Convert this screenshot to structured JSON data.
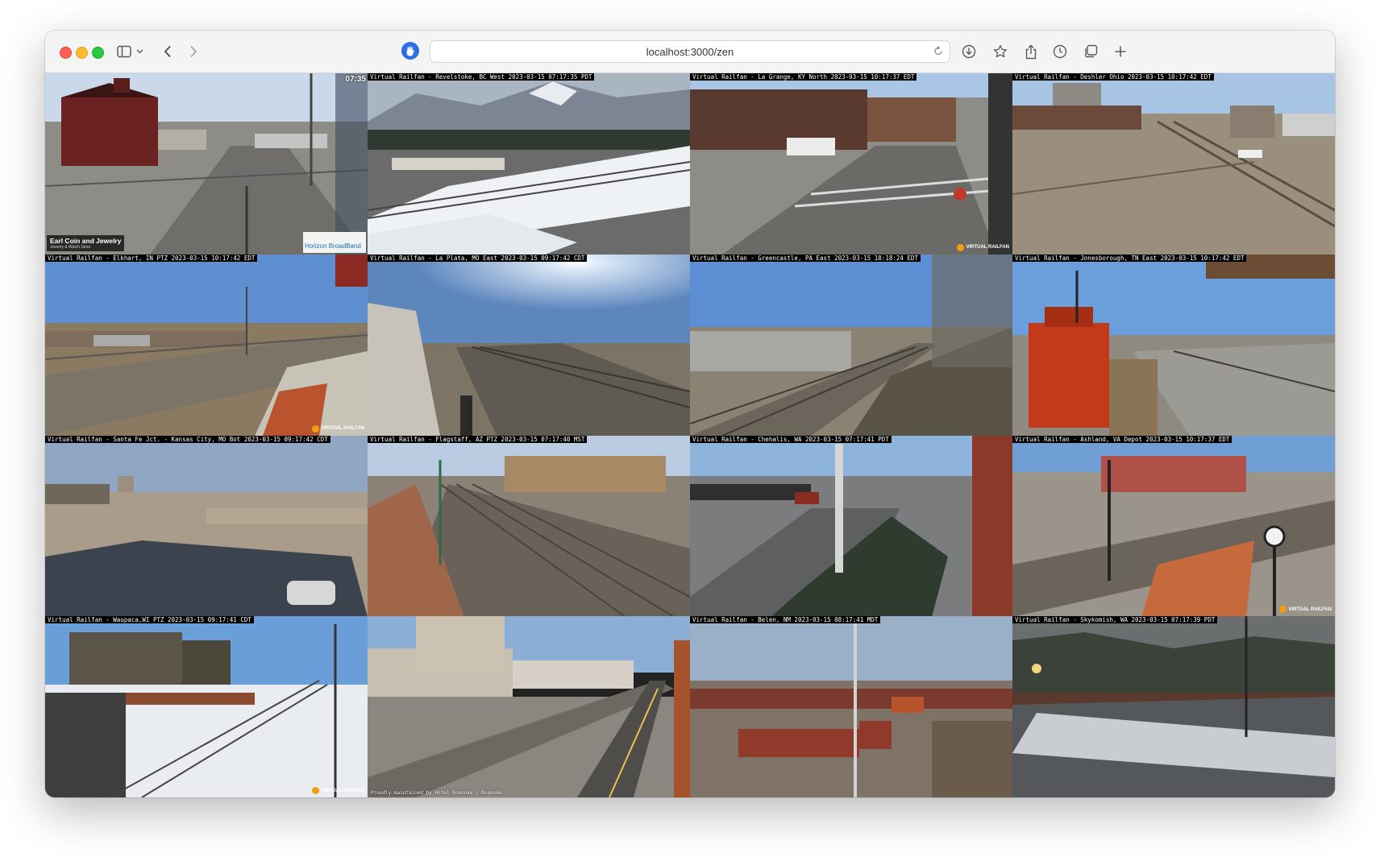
{
  "browser": {
    "url": "localhost:3000/zen",
    "icons": [
      "sidebar-icon",
      "chevron-down-icon",
      "back-icon",
      "forward-icon",
      "shield-icon",
      "reload-icon",
      "download-icon",
      "star-icon",
      "share-icon",
      "history-icon",
      "tabs-icon",
      "new-tab-icon"
    ]
  },
  "cameras": [
    {
      "label": "",
      "corner_time": "07:35",
      "store_sign": "Earl Coin and Jewelry",
      "store_sub": "Jewelry & Watch Store",
      "isp": "Horizon BroadBand"
    },
    {
      "label": "Virtual Railfan - Revelstoke, BC West 2023-03-15 07:17:35 PDT"
    },
    {
      "label": "Virtual Railfan - La Grange, KY North  2023-03-15 10:17:37 EDT"
    },
    {
      "label": "Virtual Railfan - Deshler Ohio 2023-03-15 10:17:42 EDT"
    },
    {
      "label": "Virtual Railfan - Elkhart, IN PTZ 2023-03-15 10:17:42 EDT"
    },
    {
      "label": "Virtual Railfan - La Plata, MO East 2023-03-15 09:17:42 CDT"
    },
    {
      "label": "Virtual Railfan - Greencastle, PA East 2023-03-15 10:18:24 EDT"
    },
    {
      "label": "Virtual Railfan - Jonesborough, TN East 2023-03-15 10:17:42 EDT"
    },
    {
      "label": "Virtual Railfan - Santa Fe Jct. - Kansas City, MO Bot 2023-03-15 09:17:42 CDT"
    },
    {
      "label": "Virtual Railfan - Flagstaff, AZ PTZ 2023-03-15 07:17:40 MST"
    },
    {
      "label": "Virtual Railfan - Chehalis, WA 2023-03-15 07:17:41 PDT"
    },
    {
      "label": "Virtual Railfan - Ashland, VA Depot  2023-03-15 10:17:37 EDT"
    },
    {
      "label": "Virtual Railfan - Waupaca,WI PTZ 2023-03-15 09:17:41 CDT"
    },
    {
      "label": "",
      "bottom_caption": "Proudly maintained by Hotel Roanoke | Roanoke"
    },
    {
      "label": "Virtual Railfan - Belen, NM 2023-03-15 08:17:41 MDT"
    },
    {
      "label": "Virtual Railfan - Skykomish, WA 2023-03-15 07:17:39 PDT"
    }
  ],
  "badge": "VIRTUAL RAILFAN"
}
